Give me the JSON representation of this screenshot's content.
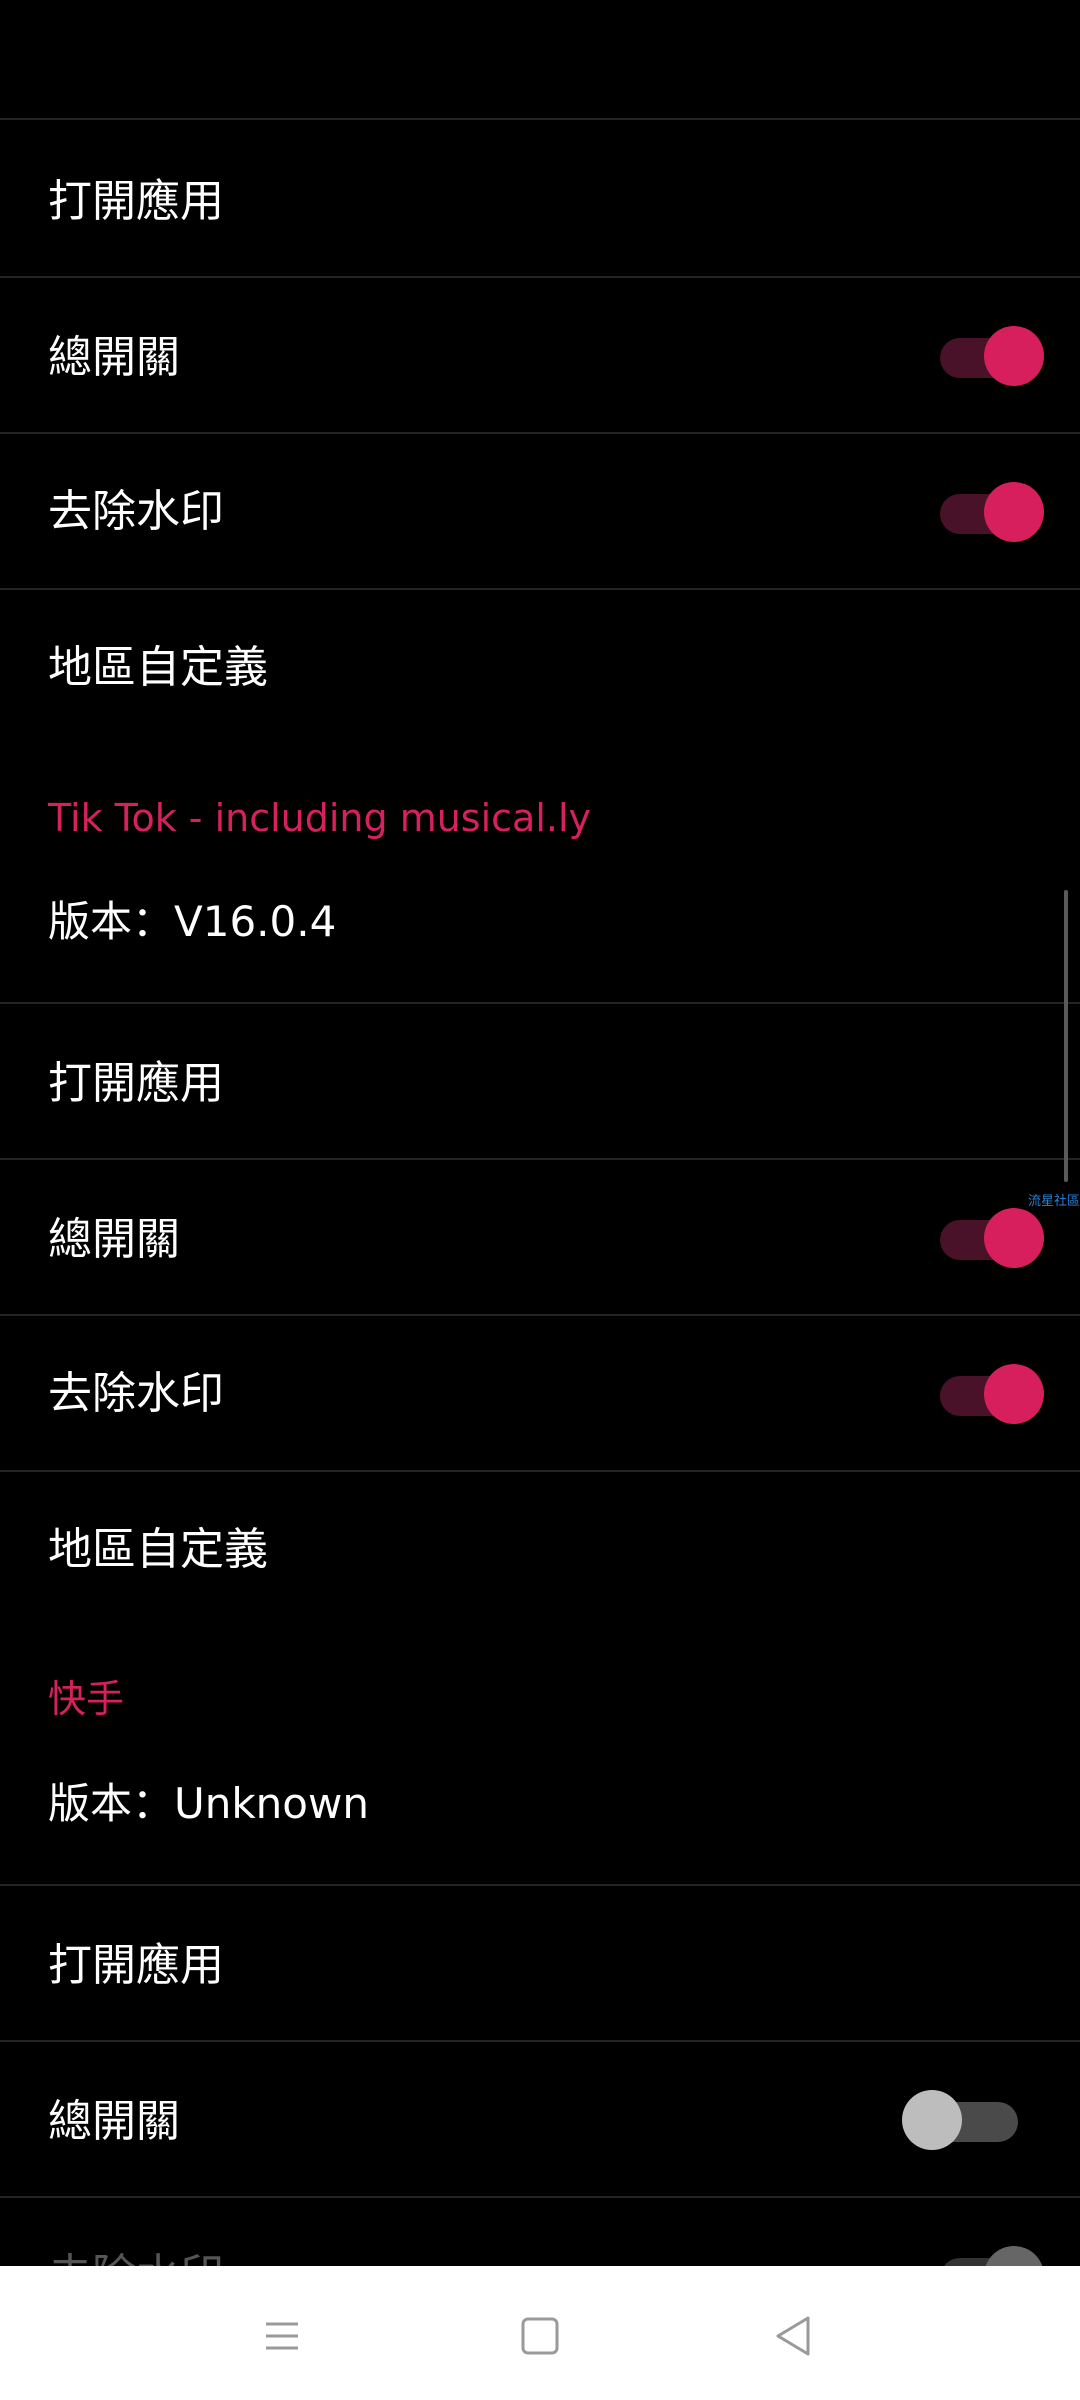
{
  "colors": {
    "accent": "#d81f5d",
    "background": "#000000",
    "divider": "#232323",
    "nav_bg": "#ffffff"
  },
  "group1": {
    "open_app": "打開應用",
    "master_switch": {
      "label": "總開關",
      "on": true
    },
    "remove_watermark": {
      "label": "去除水印",
      "on": true
    },
    "region_custom": "地區自定義"
  },
  "group2": {
    "title": "Tik Tok - including musical.ly",
    "version": "版本：V16.0.4",
    "open_app": "打開應用",
    "master_switch": {
      "label": "總開關",
      "on": true
    },
    "remove_watermark": {
      "label": "去除水印",
      "on": true
    },
    "region_custom": "地區自定義"
  },
  "group3": {
    "title": "快手",
    "version": "版本：Unknown",
    "open_app": "打開應用",
    "master_switch": {
      "label": "總開關",
      "on": false
    },
    "remove_watermark": {
      "label": "去除水印",
      "on": false
    }
  },
  "watermark_text": "流星社區",
  "navbar": {
    "icons": [
      "menu-icon",
      "home-square-icon",
      "back-triangle-icon"
    ]
  }
}
